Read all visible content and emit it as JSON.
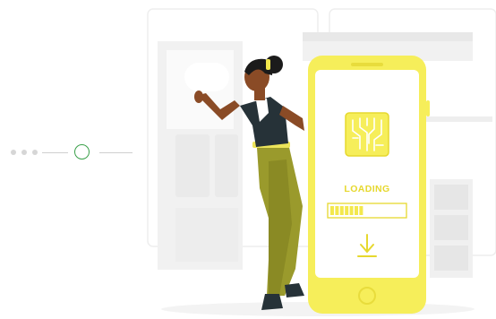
{
  "loading": {
    "label": "LOADING",
    "progress": 0.45
  },
  "stepper": {
    "total_steps": 4,
    "current_step": 4
  },
  "colors": {
    "accent_yellow": "#f6ee5a",
    "phone_border": "#f3e84c",
    "skin": "#8a4b26",
    "pants": "#9a9a2c",
    "shirt": "#263238",
    "hair": "#1b1b1b",
    "step_active": "#3aa04a",
    "step_inactive": "#d6d6d6",
    "background_fixtures": "#efefef"
  },
  "icons": {
    "chip": "microchip-icon",
    "download": "download-arrow-icon"
  }
}
